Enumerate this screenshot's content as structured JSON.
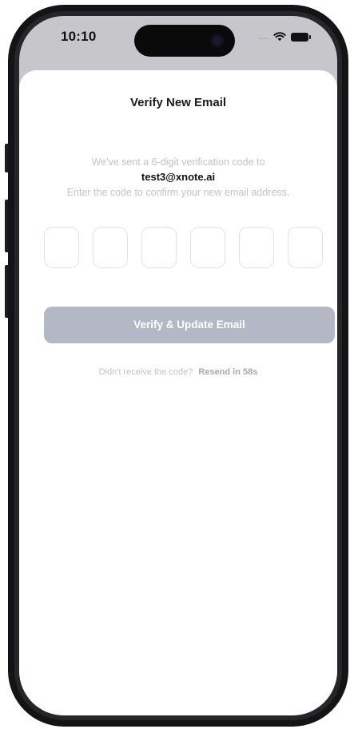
{
  "status_bar": {
    "time": "10:10",
    "signal_dots": "....",
    "icons": [
      "wifi-icon",
      "battery-icon"
    ]
  },
  "verify": {
    "title": "Verify New Email",
    "sent_message": "We've sent a 6-digit verification code to",
    "email": "test3@xnote.ai",
    "instructions": "Enter the code to confirm your new email address.",
    "code_digits": [
      "",
      "",
      "",
      "",
      "",
      ""
    ],
    "button_label": "Verify & Update Email",
    "resend_prompt": "Didn't receive the code?",
    "resend_label": "Resend in 58s"
  },
  "colors": {
    "button_disabled": "#b3b8c4",
    "box_border": "#e2e2e6",
    "muted_text": "#c3c3c8",
    "status_bar_bg": "#c7c7cb"
  }
}
